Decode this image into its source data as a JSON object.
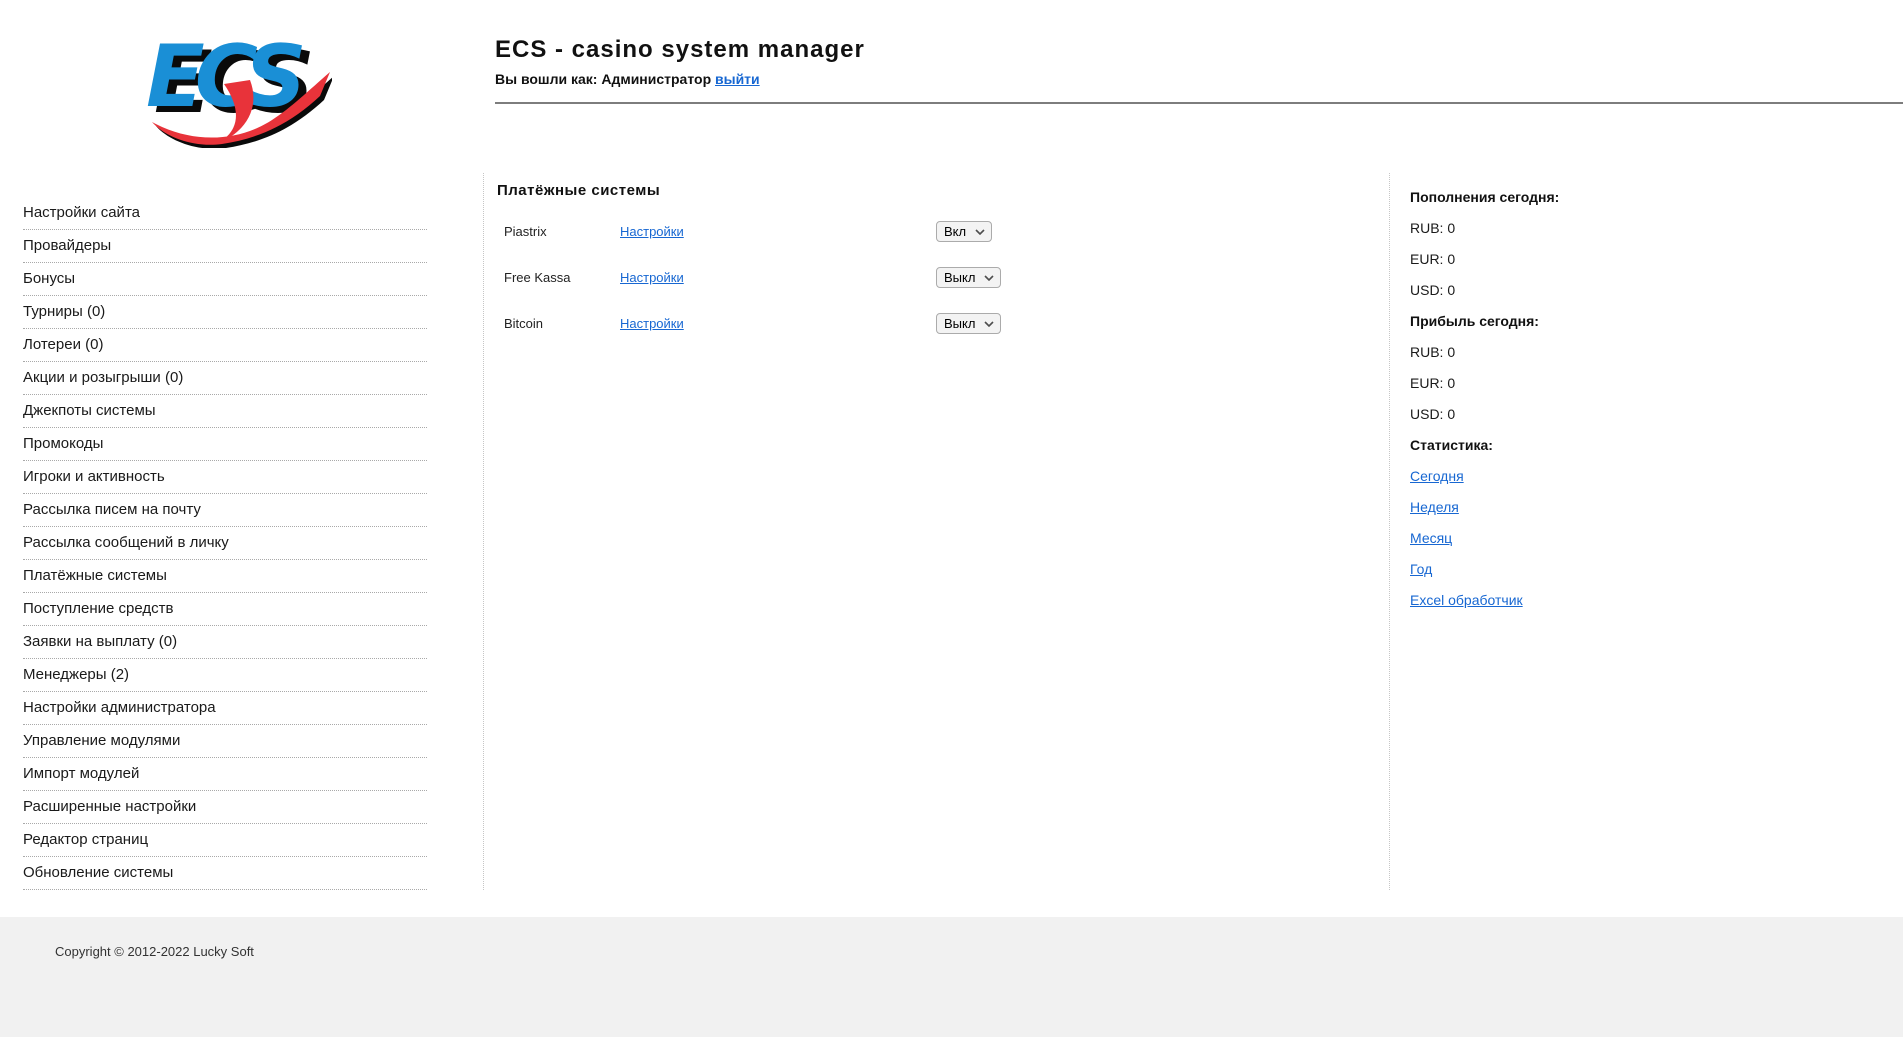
{
  "header": {
    "logo_text": "ECS",
    "title": "ECS - casino system manager",
    "login_prefix": "Вы вошли как: Администратор",
    "logout_link": "выйти"
  },
  "sidebar": {
    "items": [
      "Настройки сайта",
      "Провайдеры",
      "Бонусы",
      "Турниры (0)",
      "Лотереи (0)",
      "Акции и розыгрыши (0)",
      "Джекпоты системы",
      "Промокоды",
      "Игроки и активность",
      "Рассылка писем на почту",
      "Рассылка сообщений в личку",
      "Платёжные системы",
      "Поступление средств",
      "Заявки на выплату (0)",
      "Менеджеры (2)",
      "Настройки администратора",
      "Управление модулями",
      "Импорт модулей",
      "Расширенные настройки",
      "Редактор страниц",
      "Обновление системы"
    ]
  },
  "main": {
    "title": "Платёжные системы",
    "rows": [
      {
        "name": "Piastrix",
        "settings_label": "Настройки",
        "state": "Вкл"
      },
      {
        "name": "Free Kassa",
        "settings_label": "Настройки",
        "state": "Выкл"
      },
      {
        "name": "Bitcoin",
        "settings_label": "Настройки",
        "state": "Выкл"
      }
    ],
    "select_options": [
      "Вкл",
      "Выкл"
    ]
  },
  "stats_panel": {
    "deposits_title": "Пополнения сегодня:",
    "deposits": [
      "RUB: 0",
      "EUR: 0",
      "USD: 0"
    ],
    "profit_title": "Прибыль сегодня:",
    "profit": [
      "RUB: 0",
      "EUR: 0",
      "USD: 0"
    ],
    "stats_title": "Статистика:",
    "links": [
      "Сегодня",
      "Неделя",
      "Месяц",
      "Год",
      "Excel обработчик"
    ]
  },
  "footer": {
    "copyright": "Copyright © 2012-2022 Lucky Soft"
  },
  "colors": {
    "link_blue": "#1767d2",
    "logo_blue": "#1a8fd6",
    "logo_red": "#e8333a",
    "footer_bg": "#f1f1f1",
    "header_rule": "#7d7d7d"
  }
}
